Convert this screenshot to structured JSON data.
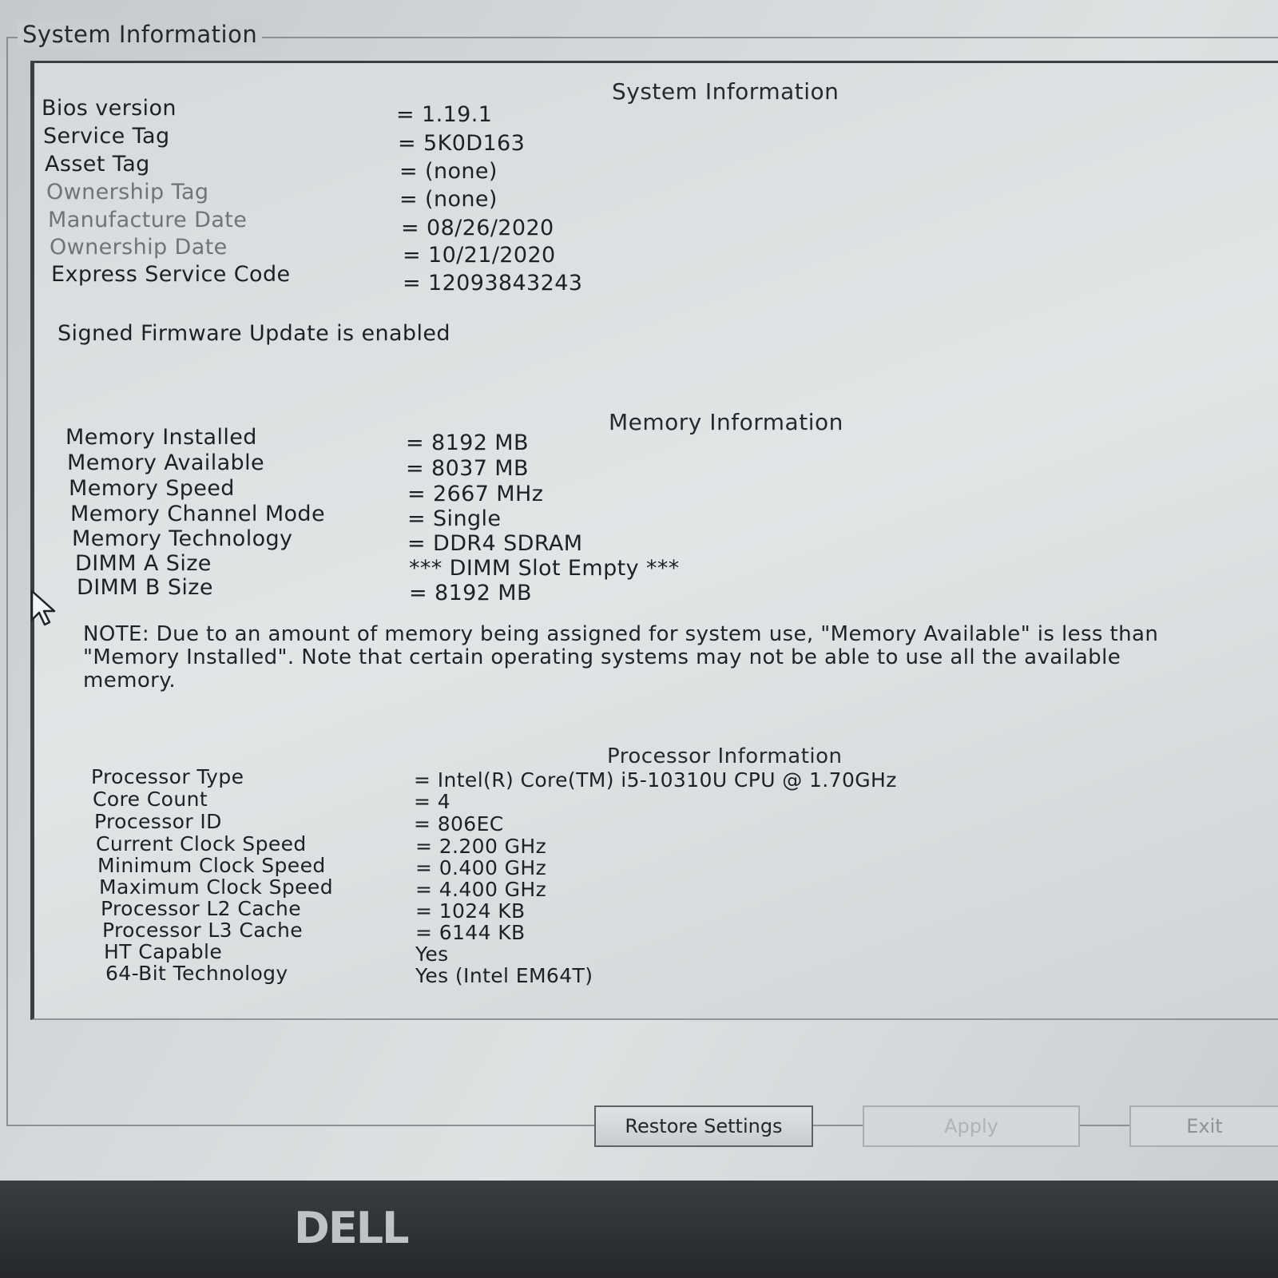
{
  "group_title": "System Information",
  "system": {
    "title": "System Information",
    "rows": [
      {
        "label": "Bios version",
        "value": "= 1.19.1"
      },
      {
        "label": "Service Tag",
        "value": "= 5K0D163"
      },
      {
        "label": "Asset Tag",
        "value": "= (none)"
      },
      {
        "label": "Ownership Tag",
        "value": "= (none)"
      },
      {
        "label": "Manufacture Date",
        "value": "= 08/26/2020"
      },
      {
        "label": "Ownership Date",
        "value": "= 10/21/2020"
      },
      {
        "label": "Express Service Code",
        "value": "= 12093843243"
      }
    ],
    "firmware_note": "Signed Firmware Update is enabled"
  },
  "memory": {
    "title": "Memory Information",
    "rows": [
      {
        "label": "Memory Installed",
        "value": "= 8192 MB"
      },
      {
        "label": "Memory Available",
        "value": "= 8037 MB"
      },
      {
        "label": "Memory Speed",
        "value": "= 2667 MHz"
      },
      {
        "label": "Memory Channel Mode",
        "value": "= Single"
      },
      {
        "label": "Memory Technology",
        "value": "= DDR4 SDRAM"
      },
      {
        "label": "DIMM A Size",
        "value": "*** DIMM Slot Empty ***"
      },
      {
        "label": "DIMM B Size",
        "value": "= 8192 MB"
      }
    ],
    "note": "NOTE: Due to an amount of memory being assigned for system use, \"Memory Available\" is less than \"Memory Installed\". Note that certain operating systems may not be able to use all the available memory."
  },
  "processor": {
    "title": "Processor Information",
    "rows": [
      {
        "label": "Processor Type",
        "value": "= Intel(R) Core(TM) i5-10310U CPU @ 1.70GHz"
      },
      {
        "label": "Core Count",
        "value": "= 4"
      },
      {
        "label": "Processor ID",
        "value": "= 806EC"
      },
      {
        "label": "Current Clock Speed",
        "value": "= 2.200 GHz"
      },
      {
        "label": "Minimum Clock Speed",
        "value": "= 0.400 GHz"
      },
      {
        "label": "Maximum Clock Speed",
        "value": "= 4.400 GHz"
      },
      {
        "label": "Processor L2 Cache",
        "value": "= 1024 KB"
      },
      {
        "label": "Processor L3 Cache",
        "value": "= 6144 KB"
      },
      {
        "label": "HT Capable",
        "value": "Yes"
      },
      {
        "label": "64-Bit Technology",
        "value": "Yes (Intel EM64T)"
      }
    ]
  },
  "buttons": {
    "restore": "Restore Settings",
    "apply": "Apply",
    "exit": "Exit"
  },
  "bezel_logo": "DELL",
  "icons": {
    "cursor": "mouse-pointer-icon"
  }
}
